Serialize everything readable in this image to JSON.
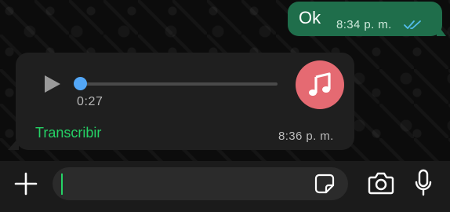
{
  "outgoing_message": {
    "text": "Ok",
    "time": "8:34 p. m.",
    "status_icon": "double-check-read-icon",
    "bubble_color": "#1f6e4b",
    "ticks_color": "#53bdeb"
  },
  "voice_message": {
    "duration": "0:27",
    "progress": 0,
    "transcribe_label": "Transcribir",
    "time": "8:36 p. m.",
    "play_icon": "play-icon",
    "avatar_icon": "music-note-icon",
    "avatar_color": "#e56a72",
    "progress_color": "#4fa3f5",
    "bubble_color": "#1f1f1f"
  },
  "composer": {
    "plus_icon": "plus-icon",
    "sticker_icon": "sticker-icon",
    "camera_icon": "camera-icon",
    "mic_icon": "microphone-icon",
    "accent": "#25d366"
  }
}
